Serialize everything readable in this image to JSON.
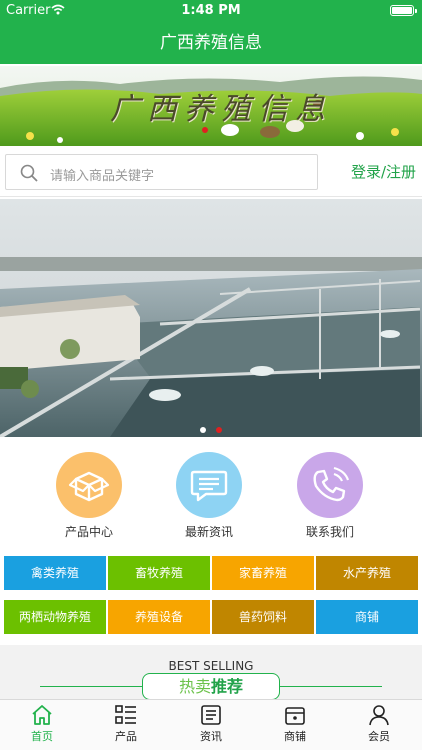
{
  "status_bar": {
    "carrier": "Carrier",
    "time": "1:48 PM"
  },
  "nav": {
    "title": "广西养殖信息"
  },
  "banner": {
    "title": "广西养殖信息"
  },
  "search": {
    "placeholder": "请输入商品关键字",
    "login_label": "登录/注册"
  },
  "carousel": {
    "dots": 2,
    "active_index": 1
  },
  "quick_links": [
    {
      "label": "产品中心",
      "icon": "box-icon",
      "color": "#fbc06b"
    },
    {
      "label": "最新资讯",
      "icon": "message-icon",
      "color": "#8ed3f3"
    },
    {
      "label": "联系我们",
      "icon": "phone-icon",
      "color": "#c9a7e9"
    }
  ],
  "categories": [
    {
      "label": "禽类养殖",
      "color": "#1aa0e0"
    },
    {
      "label": "畜牧养殖",
      "color": "#6cc000"
    },
    {
      "label": "家畜养殖",
      "color": "#f7a500"
    },
    {
      "label": "水产养殖",
      "color": "#c08600"
    },
    {
      "label": "两栖动物养殖",
      "color": "#6cc000"
    },
    {
      "label": "养殖设备",
      "color": "#f7a500"
    },
    {
      "label": "兽药饲料",
      "color": "#c08600"
    },
    {
      "label": "商铺",
      "color": "#1aa0e0"
    }
  ],
  "best_selling": {
    "title_en": "BEST SELLING",
    "title_cn_part1": "热卖",
    "title_cn_part2": "推荐"
  },
  "tabbar": {
    "items": [
      {
        "label": "首页",
        "icon": "home-icon",
        "active": true
      },
      {
        "label": "产品",
        "icon": "list-icon",
        "active": false
      },
      {
        "label": "资讯",
        "icon": "news-icon",
        "active": false
      },
      {
        "label": "商铺",
        "icon": "shop-icon",
        "active": false
      },
      {
        "label": "会员",
        "icon": "user-icon",
        "active": false
      }
    ]
  },
  "colors": {
    "brand_green": "#22b24c",
    "carousel_active_dot": "#e02020"
  }
}
